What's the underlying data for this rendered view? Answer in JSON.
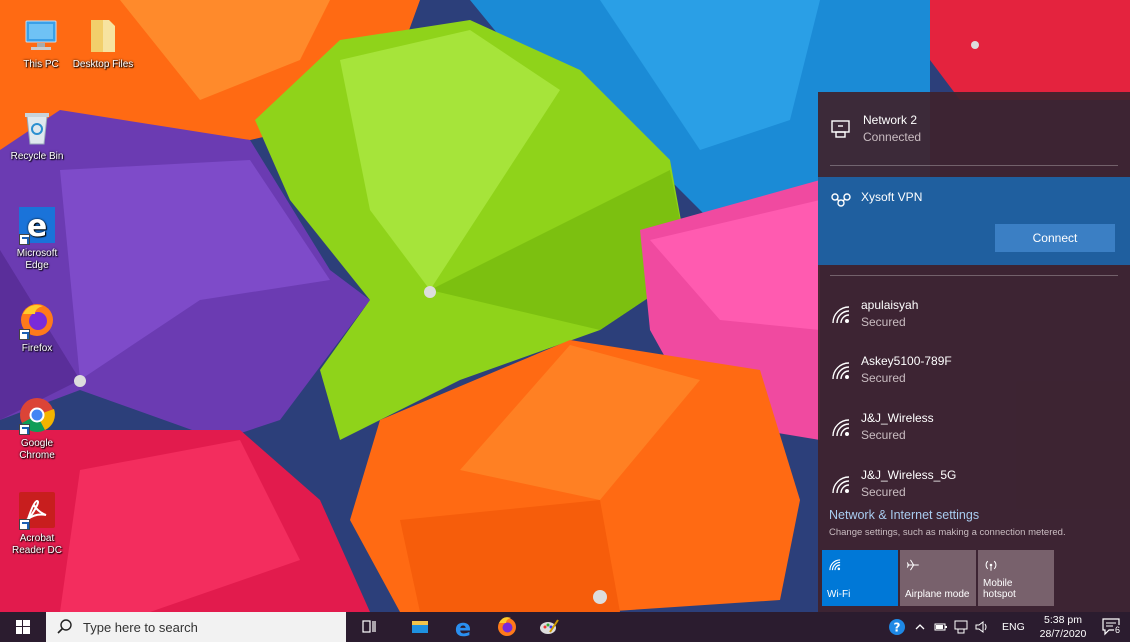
{
  "desktop": {
    "icons": [
      {
        "label": "This PC",
        "icon": "computer-icon"
      },
      {
        "label": "Desktop Files",
        "icon": "folder-icon"
      },
      {
        "label": "Recycle Bin",
        "icon": "recycle-bin-icon"
      },
      {
        "label": "Microsoft Edge",
        "icon": "edge-icon"
      },
      {
        "label": "Firefox",
        "icon": "firefox-icon"
      },
      {
        "label": "Google Chrome",
        "icon": "chrome-icon"
      },
      {
        "label": "Acrobat Reader DC",
        "icon": "acrobat-icon"
      }
    ]
  },
  "network_flyout": {
    "wired": {
      "name": "Network 2",
      "status": "Connected",
      "icon": "ethernet-icon"
    },
    "vpn": {
      "name": "Xysoft VPN",
      "button": "Connect",
      "icon": "vpn-icon"
    },
    "wifi": [
      {
        "name": "apulaisyah",
        "status": "Secured"
      },
      {
        "name": "Askey5100-789F",
        "status": "Secured"
      },
      {
        "name": "J&J_Wireless",
        "status": "Secured"
      },
      {
        "name": "J&J_Wireless_5G",
        "status": "Secured"
      }
    ],
    "settings_link": "Network & Internet settings",
    "settings_desc": "Change settings, such as making a connection metered.",
    "quick_actions": [
      {
        "label": "Wi-Fi",
        "active": true,
        "icon": "wifi-icon"
      },
      {
        "label": "Airplane mode",
        "active": false,
        "icon": "airplane-icon"
      },
      {
        "label": "Mobile\nhotspot",
        "active": false,
        "icon": "hotspot-icon"
      }
    ]
  },
  "taskbar": {
    "search_placeholder": "Type here to search",
    "apps": [
      "task-view-icon",
      "file-explorer-icon",
      "edge-icon",
      "firefox-icon",
      "paint-icon"
    ],
    "tray": {
      "language": "ENG",
      "time": "5:38 pm",
      "date": "28/7/2020",
      "notification_count": "6"
    }
  },
  "colors": {
    "flyout_bg": "#3e222d",
    "vpn_highlight": "#1f5f9f",
    "accent": "#0078d7",
    "taskbar_bg": "#2b1c2f"
  }
}
